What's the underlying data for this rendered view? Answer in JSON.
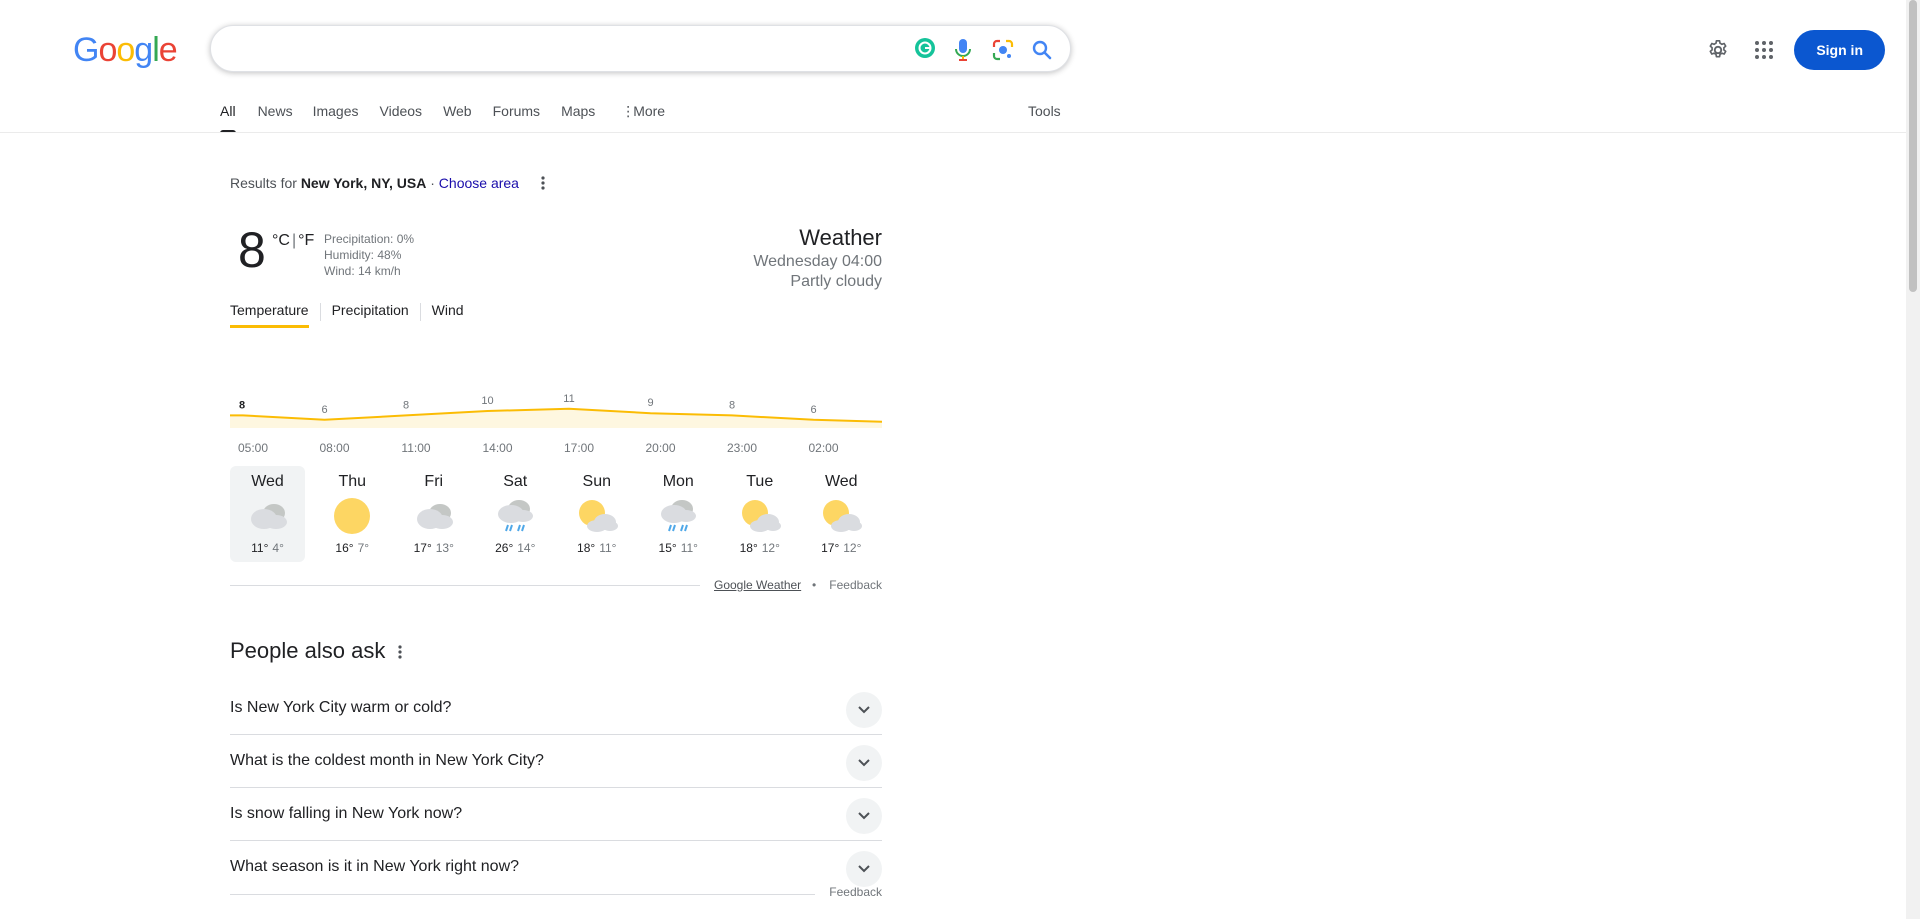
{
  "logo": {
    "text": "Google",
    "letters": [
      {
        "ch": "G",
        "color": "#4285f4"
      },
      {
        "ch": "o",
        "color": "#ea4335"
      },
      {
        "ch": "o",
        "color": "#fbbc05"
      },
      {
        "ch": "g",
        "color": "#4285f4"
      },
      {
        "ch": "l",
        "color": "#34a853"
      },
      {
        "ch": "e",
        "color": "#ea4335"
      }
    ]
  },
  "search": {
    "value": "",
    "placeholder": ""
  },
  "header": {
    "signin_label": "Sign in"
  },
  "tabs": [
    {
      "label": "All",
      "active": true
    },
    {
      "label": "News"
    },
    {
      "label": "Images"
    },
    {
      "label": "Videos"
    },
    {
      "label": "Web"
    },
    {
      "label": "Forums"
    },
    {
      "label": "Maps"
    },
    {
      "label": "More",
      "icon": "vertical-dots-icon"
    }
  ],
  "tools_label": "Tools",
  "location": {
    "prefix": "Results for",
    "place": "New York, NY, USA",
    "separator": "·",
    "choose": "Choose area"
  },
  "weather": {
    "temp": "8",
    "unit_c": "°C",
    "unit_sep": "|",
    "unit_f": "°F",
    "precipitation": "Precipitation: 0%",
    "humidity": "Humidity: 48%",
    "wind": "Wind: 14 km/h",
    "title": "Weather",
    "datetime": "Wednesday 04:00",
    "condition": "Partly cloudy",
    "tabs": [
      "Temperature",
      "Precipitation",
      "Wind"
    ],
    "hourly": {
      "times": [
        "05:00",
        "08:00",
        "11:00",
        "14:00",
        "17:00",
        "20:00",
        "23:00",
        "02:00"
      ],
      "temps": [
        8,
        6,
        8,
        10,
        11,
        9,
        8,
        6
      ]
    },
    "days": [
      {
        "name": "Wed",
        "hi": "11°",
        "lo": "4°",
        "icon": "cloudy-icon"
      },
      {
        "name": "Thu",
        "hi": "16°",
        "lo": "7°",
        "icon": "sunny-icon"
      },
      {
        "name": "Fri",
        "hi": "17°",
        "lo": "13°",
        "icon": "cloudy-icon"
      },
      {
        "name": "Sat",
        "hi": "26°",
        "lo": "14°",
        "icon": "rain-icon"
      },
      {
        "name": "Sun",
        "hi": "18°",
        "lo": "11°",
        "icon": "partly-cloudy-icon"
      },
      {
        "name": "Mon",
        "hi": "15°",
        "lo": "11°",
        "icon": "rain-icon"
      },
      {
        "name": "Tue",
        "hi": "18°",
        "lo": "12°",
        "icon": "partly-cloudy-icon"
      },
      {
        "name": "Wed",
        "hi": "17°",
        "lo": "12°",
        "icon": "partly-cloudy-icon"
      }
    ],
    "source": "Google Weather",
    "dot": "•",
    "feedback": "Feedback"
  },
  "paa": {
    "title": "People also ask",
    "questions": [
      "Is New York City warm or cold?",
      "What is the coldest month in New York City?",
      "Is snow falling in New York now?",
      "What season is it in New York right now?"
    ],
    "feedback": "Feedback"
  },
  "colors": {
    "accent": "#0b57d0",
    "temp_line": "#fbbc04",
    "temp_fill": "#fef7e0"
  }
}
